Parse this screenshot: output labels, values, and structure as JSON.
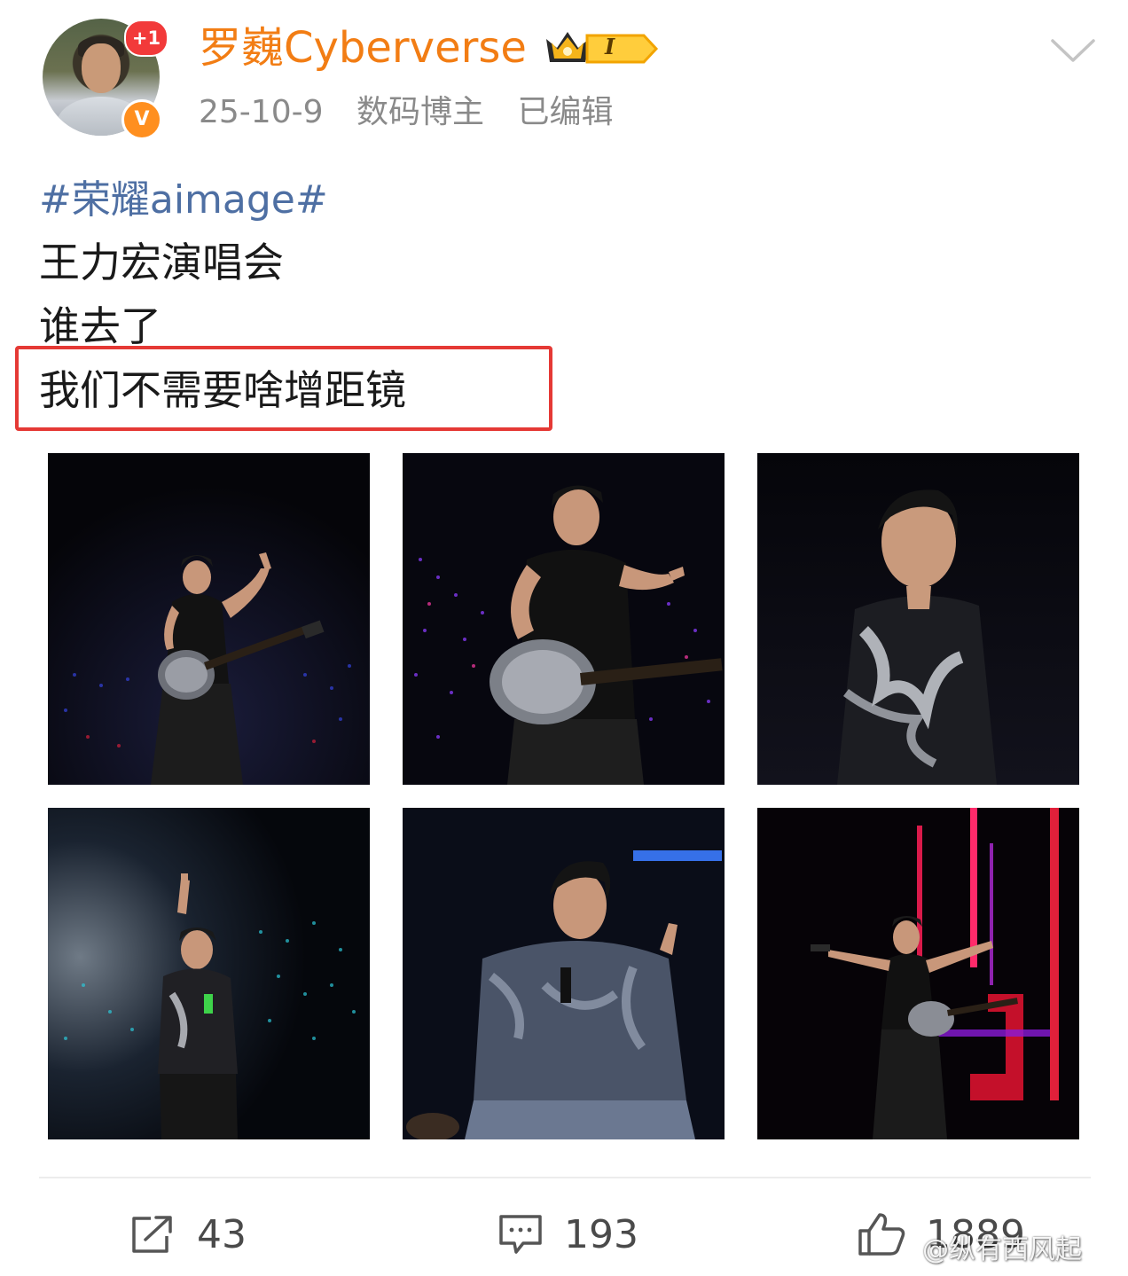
{
  "header": {
    "notification_badge": "+1",
    "verified_badge": "V",
    "username": "罗巍Cyberverse",
    "level_badge": "I",
    "date": "25-10-9",
    "user_tag": "数码博主",
    "edited_label": "已编辑",
    "accent_color": "#f27d14"
  },
  "post": {
    "hashtag": "#荣耀aimage#",
    "lines": [
      "王力宏演唱会",
      "谁去了",
      "我们不需要啥增距镜"
    ],
    "highlight_color": "#e53935"
  },
  "photos": [
    {
      "icon": "concert-photo-guitar-pointing"
    },
    {
      "icon": "concert-photo-guitar-closeup"
    },
    {
      "icon": "concert-photo-smiling-portrait"
    },
    {
      "icon": "concert-photo-pointing-up"
    },
    {
      "icon": "concert-photo-denim-jacket"
    },
    {
      "icon": "concert-photo-arms-outstretched"
    }
  ],
  "actions": {
    "repost_count": "43",
    "comment_count": "193",
    "like_count": "1889"
  },
  "watermark": "@纵有西风起"
}
